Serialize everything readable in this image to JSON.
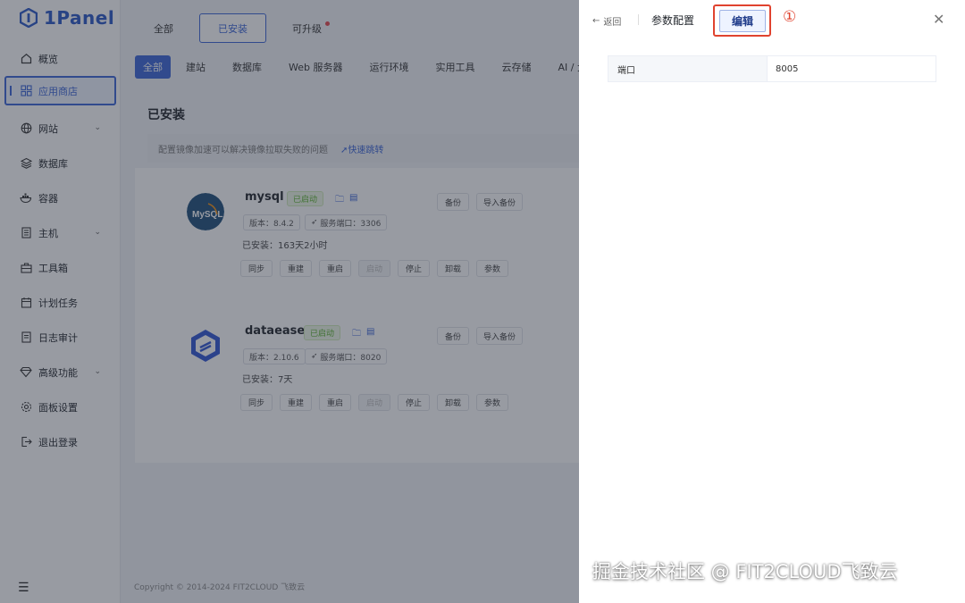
{
  "brand": {
    "name": "1Panel"
  },
  "sidebar": {
    "items": [
      {
        "label": "概览",
        "icon": "home-icon",
        "chevron": false
      },
      {
        "label": "应用商店",
        "icon": "app-grid-icon",
        "chevron": false,
        "active": true
      },
      {
        "label": "网站",
        "icon": "globe-icon",
        "chevron": true
      },
      {
        "label": "数据库",
        "icon": "layers-icon",
        "chevron": true
      },
      {
        "label": "容器",
        "icon": "docker-icon",
        "chevron": false
      },
      {
        "label": "主机",
        "icon": "server-icon",
        "chevron": true
      },
      {
        "label": "工具箱",
        "icon": "toolbox-icon",
        "chevron": false
      },
      {
        "label": "计划任务",
        "icon": "calendar-icon",
        "chevron": false
      },
      {
        "label": "日志审计",
        "icon": "log-icon",
        "chevron": false
      },
      {
        "label": "高级功能",
        "icon": "diamond-icon",
        "chevron": true
      },
      {
        "label": "面板设置",
        "icon": "gear-icon",
        "chevron": false
      },
      {
        "label": "退出登录",
        "icon": "logout-icon",
        "chevron": false
      }
    ]
  },
  "top_tabs": [
    {
      "label": "全部"
    },
    {
      "label": "已安装",
      "active": true
    },
    {
      "label": "可升级",
      "badge": true
    }
  ],
  "categories": [
    "全部",
    "建站",
    "数据库",
    "Web 服务器",
    "运行环境",
    "实用工具",
    "云存储",
    "AI / 大"
  ],
  "section_title": "已安装",
  "notice": {
    "text": "配置镜像加速可以解决镜像拉取失败的问题",
    "link": "快速跳转"
  },
  "apps": [
    {
      "name": "mysql",
      "status": "已启动",
      "version": "版本：8.4.2",
      "port": "服务端口：3306",
      "installed": "已安装：163天2小时",
      "right_actions": [
        "备份",
        "导入备份"
      ],
      "actions": [
        "同步",
        "重建",
        "重启",
        "启动",
        "停止",
        "卸载",
        "参数"
      ]
    },
    {
      "name": "dataease",
      "status": "已启动",
      "version": "版本：2.10.6",
      "port": "服务端口：8020",
      "installed": "已安装：7天",
      "right_actions": [
        "备份",
        "导入备份"
      ],
      "actions": [
        "同步",
        "重建",
        "重启",
        "启动",
        "停止",
        "卸载",
        "参数"
      ]
    }
  ],
  "footer": "Copyright © 2014-2024 FIT2CLOUD 飞致云",
  "drawer": {
    "back": "返回",
    "title": "参数配置",
    "edit": "编辑",
    "step_marker": "①",
    "params": [
      {
        "key": "端口",
        "value": "8005"
      }
    ]
  },
  "watermark": "掘金技术社区 @ FIT2CLOUD飞致云"
}
